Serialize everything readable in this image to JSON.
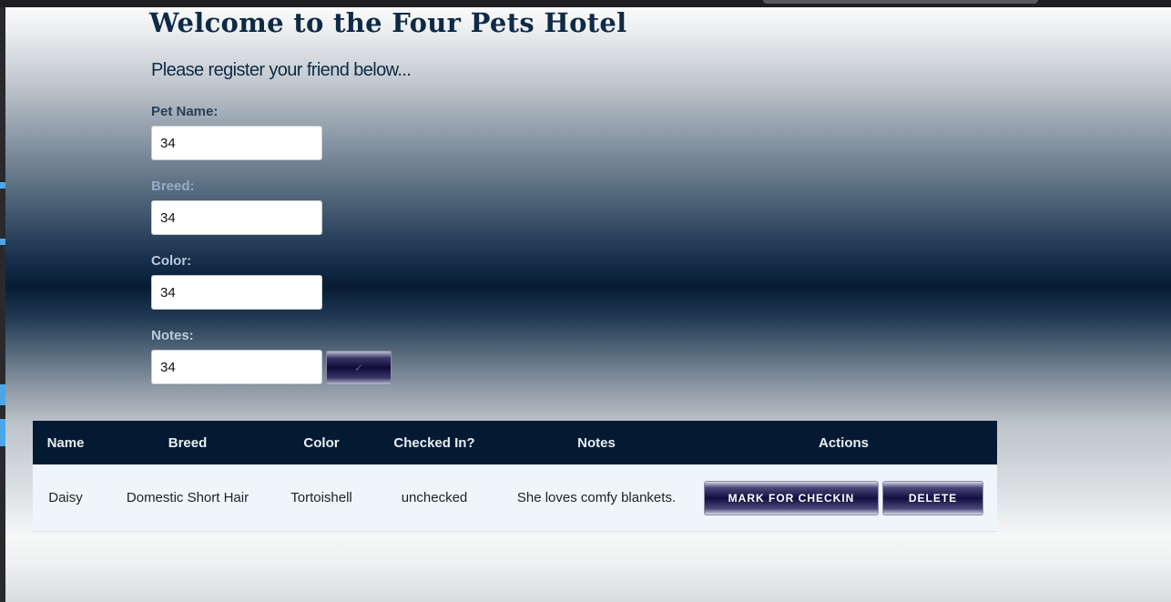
{
  "header": {
    "title": "Welcome to the Four Pets Hotel",
    "subtitle": "Please register your friend below..."
  },
  "form": {
    "pet_name": {
      "label": "Pet Name:",
      "value": "34",
      "label_color": "#2a3e55"
    },
    "breed": {
      "label": "Breed:",
      "value": "34",
      "label_color": "#94aac4"
    },
    "color": {
      "label": "Color:",
      "value": "34",
      "label_color": "#b9cadc"
    },
    "notes": {
      "label": "Notes:",
      "value": "34",
      "label_color": "#b9cadc"
    },
    "submit_label": "✓"
  },
  "table": {
    "headers": [
      "Name",
      "Breed",
      "Color",
      "Checked In?",
      "Notes",
      "Actions"
    ],
    "rows": [
      {
        "name": "Daisy",
        "breed": "Domestic Short Hair",
        "color": "Tortoishell",
        "checked_in": "unchecked",
        "notes": "She loves comfy blankets.",
        "checkin_label": "MARK FOR CHECKIN",
        "delete_label": "DELETE"
      }
    ]
  },
  "colors": {
    "header_bg": "#041a33",
    "row_bg": "#eef6fc",
    "title_text": "#0f2a45"
  }
}
